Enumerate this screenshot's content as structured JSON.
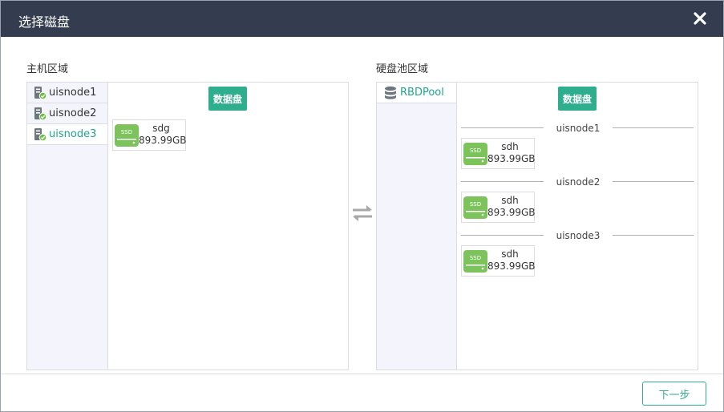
{
  "dialog": {
    "title": "选择磁盘",
    "next_label": "下一步"
  },
  "host_area": {
    "label": "主机区域",
    "nodes": [
      {
        "name": "uisnode1",
        "selected": false
      },
      {
        "name": "uisnode2",
        "selected": false
      },
      {
        "name": "uisnode3",
        "selected": true
      }
    ],
    "pill_label": "数据盘",
    "disks": [
      {
        "badge": "SSD",
        "name": "sdg",
        "size": "893.99GB"
      }
    ]
  },
  "pool_area": {
    "label": "硬盘池区域",
    "pools": [
      {
        "name": "RBDPool",
        "selected": true
      }
    ],
    "pill_label": "数据盘",
    "groups": [
      {
        "node": "uisnode1",
        "disk": {
          "badge": "SSD",
          "name": "sdh",
          "size": "893.99GB"
        }
      },
      {
        "node": "uisnode2",
        "disk": {
          "badge": "SSD",
          "name": "sdh",
          "size": "893.99GB"
        }
      },
      {
        "node": "uisnode3",
        "disk": {
          "badge": "SSD",
          "name": "sdh",
          "size": "893.99GB"
        }
      }
    ]
  },
  "colors": {
    "titlebar": "#333d4f",
    "accent": "#2fae8e",
    "ssd_green": "#7dc35b",
    "ok_badge": "#6cbf3d"
  },
  "icons": {
    "close": "close-icon",
    "server": "server-node-icon",
    "database": "database-icon",
    "ssd": "ssd-icon",
    "swap": "swap-arrows-icon"
  }
}
